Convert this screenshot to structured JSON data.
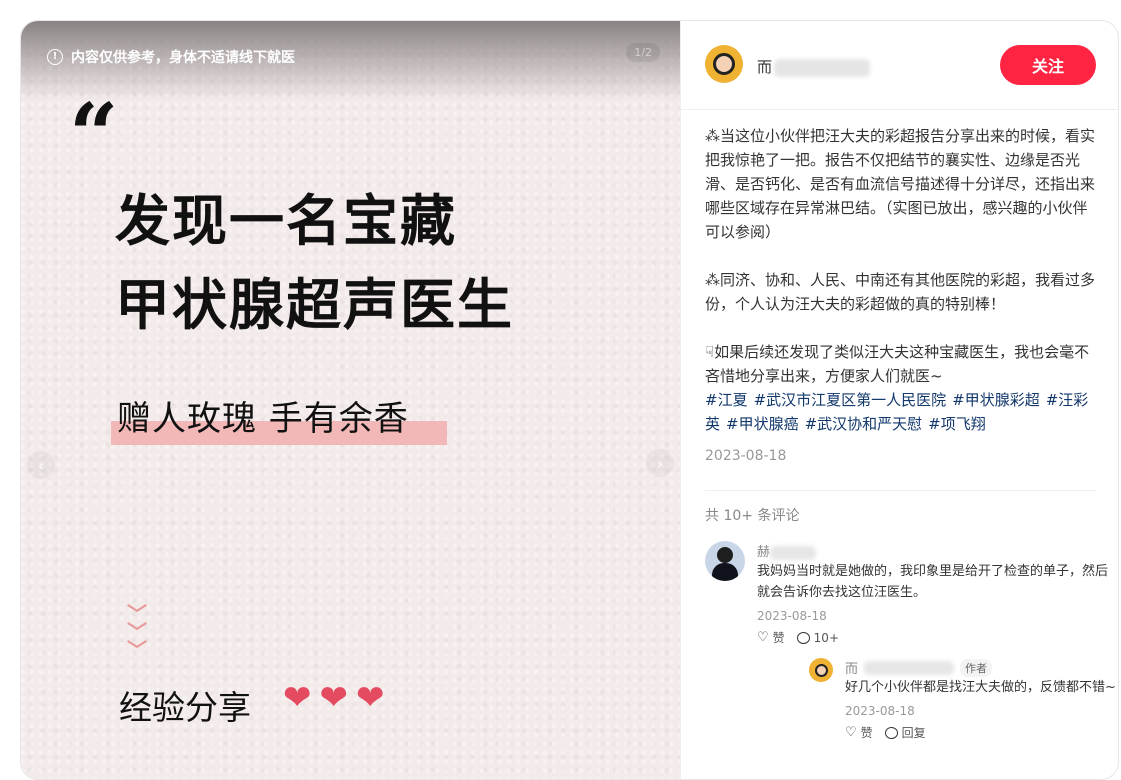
{
  "media": {
    "notice": "内容仅供参考，身体不适请线下就医",
    "counter": "1/2",
    "quote_mark": "“",
    "headline_line1": "发现一名宝藏",
    "headline_line2": "甲状腺超声医生",
    "slogan": "赠人玫瑰 手有余香",
    "chevrons": "⌄⌄⌄",
    "share_label": "经验分享",
    "prev_arrow": "‹",
    "next_arrow": "›",
    "hearts": [
      "❤",
      "❤",
      "❤"
    ],
    "accent_color": "#e54b60",
    "highlight_color": "#f2b8b8"
  },
  "author": {
    "name_visible": "而",
    "follow_label": "关注",
    "follow_color": "#ff2442"
  },
  "post": {
    "paragraph1": "⁂当这位小伙伴把汪大夫的彩超报告分享出来的时候，看实把我惊艳了一把。报告不仅把结节的襄实性、边缘是否光滑、是否钙化、是否有血流信号描述得十分详尽，还指出来哪些区域存在异常淋巴结。（实图已放出，感兴趣的小伙伴可以参阅）",
    "paragraph2": "⁂同济、协和、人民、中南还有其他医院的彩超，我看过多份，个人认为汪大夫的彩超做的真的特别棒！",
    "paragraph3": "☟如果后续还发现了类似汪大夫这种宝藏医生，我也会毫不吝惜地分享出来，方便家人们就医~",
    "tags": [
      "#江夏",
      "#武汉市江夏区第一人民医院",
      "#甲状腺彩超",
      "#汪彩英",
      "#甲状腺癌",
      "#武汉协和严天慰",
      "#项飞翔"
    ],
    "date": "2023-08-18"
  },
  "comments": {
    "total": "共 10+ 条评论",
    "items": [
      {
        "name_visible": "赫",
        "text": "我妈妈当时就是她做的，我印象里是给开了检查的单子，然后就会告诉你去找这位汪医生。",
        "date": "2023-08-18",
        "like_label": "赞",
        "reply_count": "10+"
      }
    ],
    "reply": {
      "name_visible": "而",
      "badge": "作者",
      "text": "好几个小伙伴都是找汪大夫做的，反馈都不错~",
      "date": "2023-08-18",
      "like_label": "赞",
      "reply_label": "回复"
    }
  }
}
